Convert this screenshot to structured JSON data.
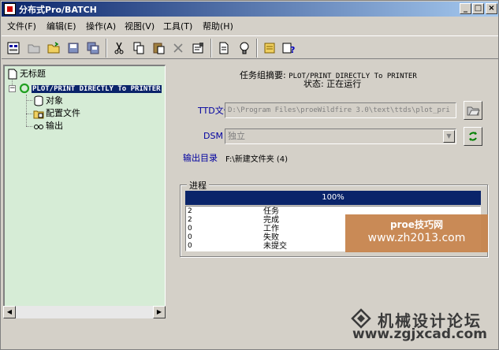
{
  "window": {
    "title": "分布式Pro/BATCH",
    "controls": {
      "minimize": "_",
      "maximize": "□",
      "close": "×"
    }
  },
  "menubar": {
    "items": [
      {
        "label": "文件(F)"
      },
      {
        "label": "编辑(E)"
      },
      {
        "label": "操作(A)"
      },
      {
        "label": "视图(V)"
      },
      {
        "label": "工具(T)"
      },
      {
        "label": "帮助(H)"
      }
    ]
  },
  "toolbar": {
    "buttons": [
      "batch-icon",
      "open-folder-icon",
      "open-icon",
      "save-icon",
      "save-all-icon",
      "cut-icon",
      "copy-icon",
      "paste-icon",
      "delete-icon",
      "properties-icon",
      "document-icon",
      "bulb-icon",
      "pages-icon",
      "help-icon"
    ]
  },
  "tree": {
    "root": "无标题",
    "task": "PLOT/PRINT DIRECTLY To PRINTER",
    "children": [
      "对象",
      "配置文件",
      "输出"
    ]
  },
  "summary": {
    "title_prefix": "任务组摘要:",
    "title_task": "PLOT/PRINT DIRECTLY To PRINTER",
    "status": "状态: 正在运行"
  },
  "fields": {
    "ttd_label": "TTD文件",
    "ttd_value": "D:\\Program Files\\proeWildfire 3.0\\text\\ttds\\plot_pri",
    "dsm_label": "DSM",
    "dsm_value": "独立",
    "outdir_label": "输出目录",
    "outdir_value": "F:\\新建文件夹 (4)"
  },
  "progress": {
    "group_label": "进程",
    "percent_text": "100%",
    "percent": 100,
    "stats": [
      {
        "count": "2",
        "label": "任务"
      },
      {
        "count": "2",
        "label": "完成"
      },
      {
        "count": "0",
        "label": "工作"
      },
      {
        "count": "0",
        "label": "失败"
      },
      {
        "count": "0",
        "label": "未提交"
      }
    ]
  },
  "watermark": {
    "site_name": "proe技巧网",
    "site_url": "www.zh2013.com",
    "forum_name": "机械设计论坛",
    "forum_url": "www.zgjxcad.com"
  },
  "colors": {
    "selection": "#0a246a",
    "tree_bg": "#d6ecd6",
    "window_bg": "#d4d0c8",
    "label_blue": "#0000a0"
  }
}
